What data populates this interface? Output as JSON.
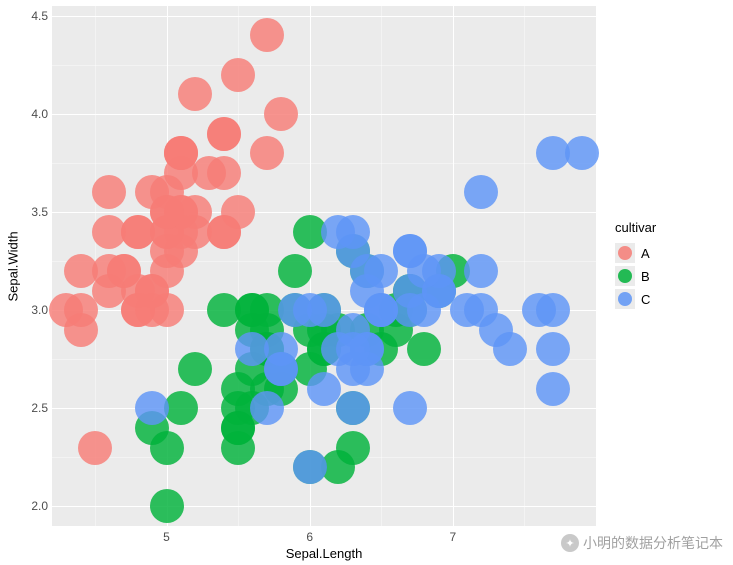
{
  "chart_data": {
    "type": "scatter",
    "xlabel": "Sepal.Length",
    "ylabel": "Sepal.Width",
    "xlim": [
      4.2,
      8.0
    ],
    "ylim": [
      1.9,
      4.55
    ],
    "x_ticks": [
      5,
      6,
      7
    ],
    "y_ticks": [
      2.0,
      2.5,
      3.0,
      3.5,
      4.0,
      4.5
    ],
    "legend_title": "cultivar",
    "series": [
      {
        "name": "A",
        "color": "#f67d76",
        "points": [
          [
            5.1,
            3.5
          ],
          [
            4.9,
            3.0
          ],
          [
            4.7,
            3.2
          ],
          [
            4.6,
            3.1
          ],
          [
            5.0,
            3.6
          ],
          [
            5.4,
            3.9
          ],
          [
            4.6,
            3.4
          ],
          [
            5.0,
            3.4
          ],
          [
            4.4,
            2.9
          ],
          [
            4.9,
            3.1
          ],
          [
            5.4,
            3.7
          ],
          [
            4.8,
            3.4
          ],
          [
            4.8,
            3.0
          ],
          [
            4.3,
            3.0
          ],
          [
            5.8,
            4.0
          ],
          [
            5.7,
            4.4
          ],
          [
            5.4,
            3.9
          ],
          [
            5.1,
            3.5
          ],
          [
            5.7,
            3.8
          ],
          [
            5.1,
            3.8
          ],
          [
            5.4,
            3.4
          ],
          [
            5.1,
            3.7
          ],
          [
            4.6,
            3.6
          ],
          [
            5.1,
            3.3
          ],
          [
            4.8,
            3.4
          ],
          [
            5.0,
            3.0
          ],
          [
            5.0,
            3.4
          ],
          [
            5.2,
            3.5
          ],
          [
            5.2,
            3.4
          ],
          [
            4.7,
            3.2
          ],
          [
            4.8,
            3.1
          ],
          [
            5.4,
            3.4
          ],
          [
            5.2,
            4.1
          ],
          [
            5.5,
            4.2
          ],
          [
            4.9,
            3.1
          ],
          [
            5.0,
            3.2
          ],
          [
            5.5,
            3.5
          ],
          [
            4.9,
            3.6
          ],
          [
            4.4,
            3.0
          ],
          [
            5.1,
            3.4
          ],
          [
            5.0,
            3.5
          ],
          [
            4.5,
            2.3
          ],
          [
            4.4,
            3.2
          ],
          [
            5.0,
            3.5
          ],
          [
            5.1,
            3.8
          ],
          [
            4.8,
            3.0
          ],
          [
            5.1,
            3.8
          ],
          [
            4.6,
            3.2
          ],
          [
            5.3,
            3.7
          ],
          [
            5.0,
            3.3
          ]
        ]
      },
      {
        "name": "B",
        "color": "#00b23a",
        "points": [
          [
            7.0,
            3.2
          ],
          [
            6.4,
            3.2
          ],
          [
            6.9,
            3.1
          ],
          [
            5.5,
            2.3
          ],
          [
            6.5,
            2.8
          ],
          [
            5.7,
            2.8
          ],
          [
            6.3,
            3.3
          ],
          [
            4.9,
            2.4
          ],
          [
            6.6,
            2.9
          ],
          [
            5.2,
            2.7
          ],
          [
            5.0,
            2.0
          ],
          [
            5.9,
            3.0
          ],
          [
            6.0,
            2.2
          ],
          [
            6.1,
            2.9
          ],
          [
            5.6,
            2.9
          ],
          [
            6.7,
            3.1
          ],
          [
            5.6,
            3.0
          ],
          [
            5.8,
            2.7
          ],
          [
            6.2,
            2.2
          ],
          [
            5.6,
            2.5
          ],
          [
            5.9,
            3.2
          ],
          [
            6.1,
            2.8
          ],
          [
            6.3,
            2.5
          ],
          [
            6.1,
            2.8
          ],
          [
            6.4,
            2.9
          ],
          [
            6.6,
            3.0
          ],
          [
            6.8,
            2.8
          ],
          [
            6.7,
            3.0
          ],
          [
            6.0,
            2.9
          ],
          [
            5.7,
            2.6
          ],
          [
            5.5,
            2.4
          ],
          [
            5.5,
            2.4
          ],
          [
            5.8,
            2.7
          ],
          [
            6.0,
            2.7
          ],
          [
            5.4,
            3.0
          ],
          [
            6.0,
            3.4
          ],
          [
            6.7,
            3.1
          ],
          [
            6.3,
            2.3
          ],
          [
            5.6,
            3.0
          ],
          [
            5.5,
            2.5
          ],
          [
            5.5,
            2.6
          ],
          [
            6.1,
            3.0
          ],
          [
            5.8,
            2.6
          ],
          [
            5.0,
            2.3
          ],
          [
            5.6,
            2.7
          ],
          [
            5.7,
            3.0
          ],
          [
            5.7,
            2.9
          ],
          [
            6.2,
            2.9
          ],
          [
            5.1,
            2.5
          ],
          [
            5.7,
            2.8
          ]
        ]
      },
      {
        "name": "C",
        "color": "#5e95f6",
        "points": [
          [
            6.3,
            3.3
          ],
          [
            5.8,
            2.7
          ],
          [
            7.1,
            3.0
          ],
          [
            6.3,
            2.9
          ],
          [
            6.5,
            3.0
          ],
          [
            7.6,
            3.0
          ],
          [
            4.9,
            2.5
          ],
          [
            7.3,
            2.9
          ],
          [
            6.7,
            2.5
          ],
          [
            7.2,
            3.6
          ],
          [
            6.5,
            3.2
          ],
          [
            6.4,
            2.7
          ],
          [
            6.8,
            3.0
          ],
          [
            5.7,
            2.5
          ],
          [
            5.8,
            2.8
          ],
          [
            6.4,
            3.2
          ],
          [
            6.5,
            3.0
          ],
          [
            7.7,
            3.8
          ],
          [
            7.7,
            2.6
          ],
          [
            6.0,
            2.2
          ],
          [
            6.9,
            3.2
          ],
          [
            5.6,
            2.8
          ],
          [
            7.7,
            2.8
          ],
          [
            6.3,
            2.7
          ],
          [
            6.7,
            3.3
          ],
          [
            7.2,
            3.2
          ],
          [
            6.2,
            2.8
          ],
          [
            6.1,
            3.0
          ],
          [
            6.4,
            2.8
          ],
          [
            7.2,
            3.0
          ],
          [
            7.4,
            2.8
          ],
          [
            7.9,
            3.8
          ],
          [
            6.4,
            2.8
          ],
          [
            6.3,
            2.8
          ],
          [
            6.1,
            2.6
          ],
          [
            7.7,
            3.0
          ],
          [
            6.3,
            3.4
          ],
          [
            6.4,
            3.1
          ],
          [
            6.0,
            3.0
          ],
          [
            6.9,
            3.1
          ],
          [
            6.7,
            3.1
          ],
          [
            6.9,
            3.1
          ],
          [
            5.8,
            2.7
          ],
          [
            6.8,
            3.2
          ],
          [
            6.7,
            3.3
          ],
          [
            6.7,
            3.0
          ],
          [
            6.3,
            2.5
          ],
          [
            6.5,
            3.0
          ],
          [
            6.2,
            3.4
          ],
          [
            5.9,
            3.0
          ]
        ]
      }
    ]
  },
  "watermark": {
    "text": "小明的数据分析笔记本",
    "icon_label": "wechat"
  }
}
